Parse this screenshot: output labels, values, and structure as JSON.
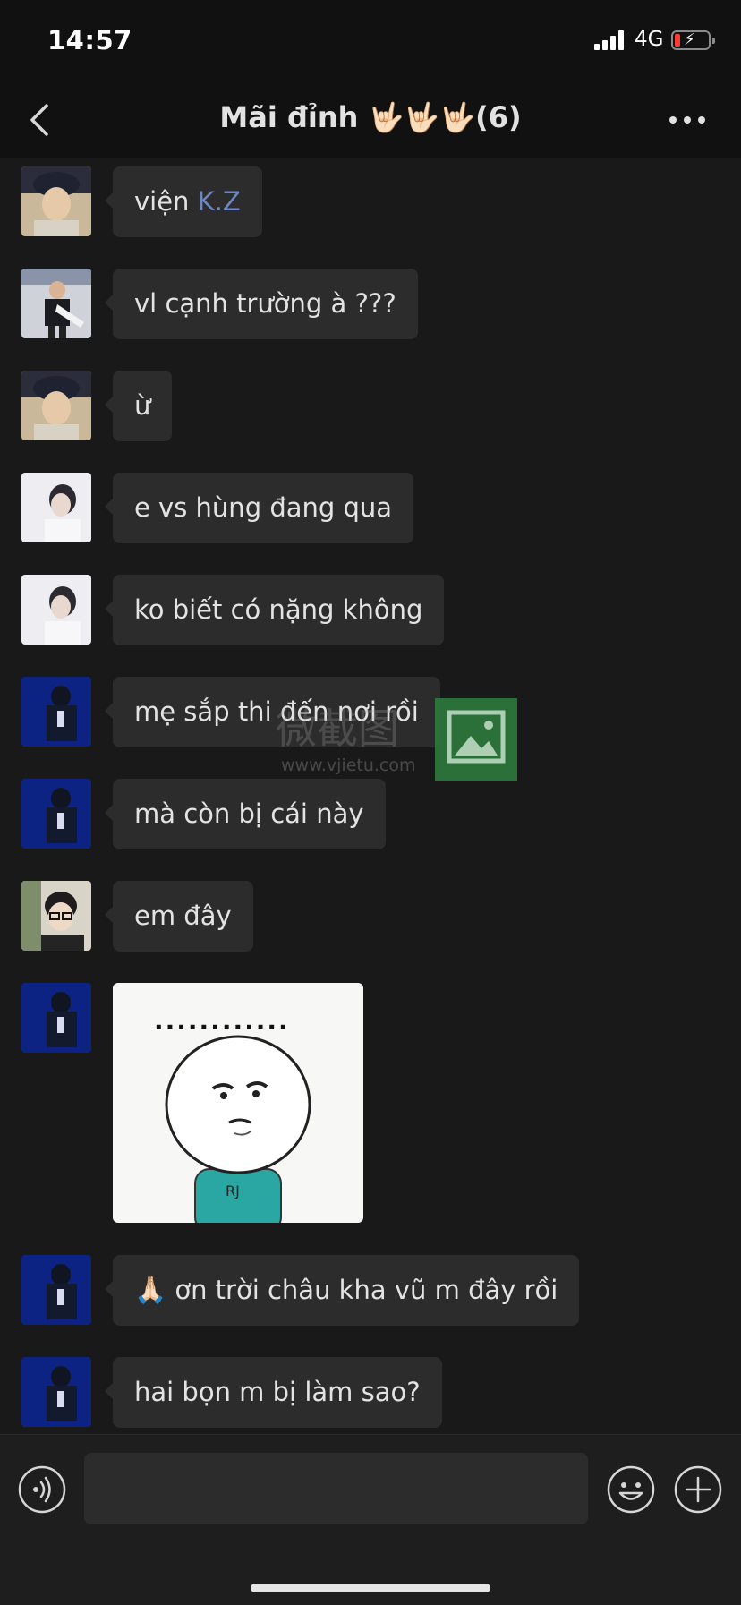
{
  "status_bar": {
    "time": "14:57",
    "network": "4G"
  },
  "header": {
    "title": "Mãi đỉnh 🤟🏻🤟🏻🤟🏻(6)"
  },
  "messages": [
    {
      "text": "viện ",
      "mention": "K.Z"
    },
    {
      "text": "vl cạnh trường à ???"
    },
    {
      "text": "ừ"
    },
    {
      "text": "e vs hùng đang qua"
    },
    {
      "text": "ko biết có nặng không"
    },
    {
      "text": "mẹ sắp thi đến nơi rồi"
    },
    {
      "text": "mà còn bị cái này"
    },
    {
      "text": "em đây"
    },
    {
      "sticker_dots": "............"
    },
    {
      "text": "🙏🏻 ơn trời châu kha vũ  m đây rồi"
    },
    {
      "text": "hai bọn m bị làm sao?"
    }
  ],
  "watermark": {
    "text": "微截图",
    "url": "www.vjietu.com"
  },
  "input_bar": {
    "placeholder": ""
  },
  "colors": {
    "background": "#191919",
    "bubble": "#2c2c2c",
    "mention": "#6f86c4",
    "header": "#111111"
  }
}
